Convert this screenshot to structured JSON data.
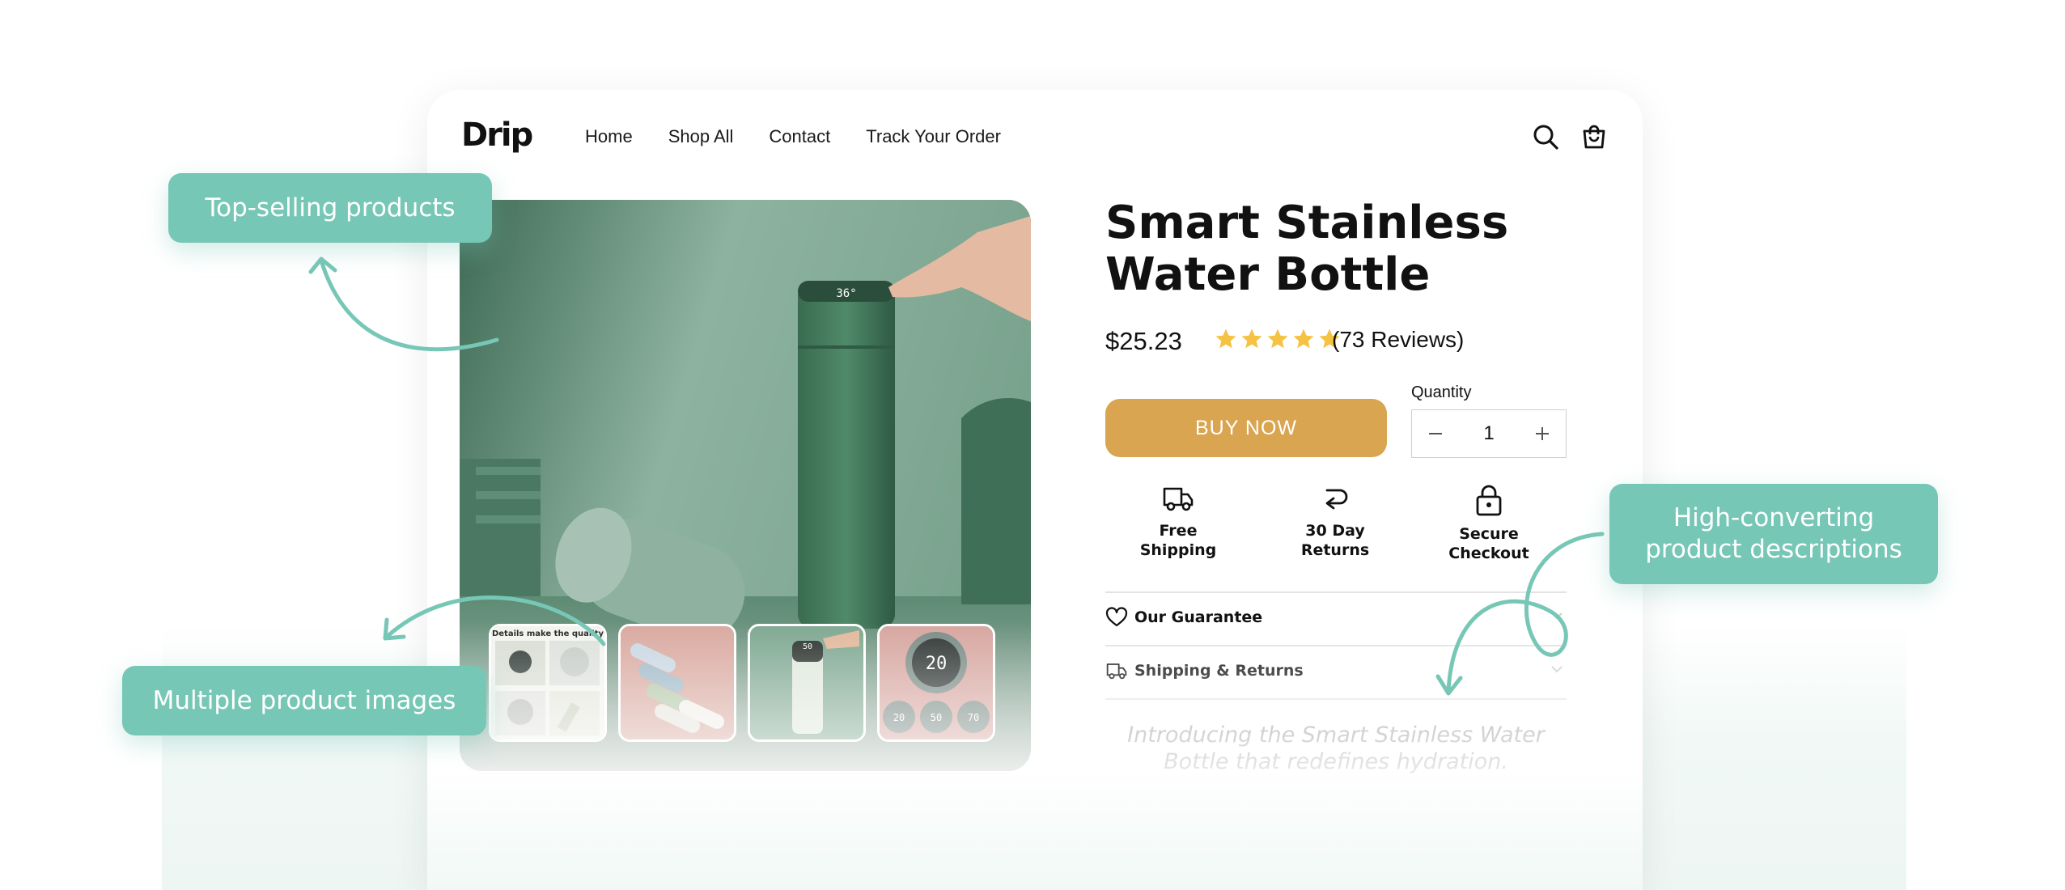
{
  "header": {
    "logo": "Drip",
    "nav": [
      "Home",
      "Shop All",
      "Contact",
      "Track Your Order"
    ],
    "icons": [
      "search-icon",
      "cart-icon"
    ]
  },
  "product": {
    "title": "Smart Stainless Water Bottle",
    "price": "$25.23",
    "rating": 5,
    "reviews": "(73 Reviews)",
    "buy_label": "BUY NOW",
    "quantity_label": "Quantity",
    "quantity_value": "1",
    "thumbnail_caption": "Details make the quality",
    "thumbnail_readouts": [
      "50",
      "20",
      "20",
      "50",
      "70"
    ],
    "features": [
      {
        "line1": "Free",
        "line2": "Shipping",
        "icon": "truck-icon"
      },
      {
        "line1": "30 Day",
        "line2": "Returns",
        "icon": "return-arrow-icon"
      },
      {
        "line1": "Secure",
        "line2": "Checkout",
        "icon": "lock-icon"
      }
    ],
    "accordion": [
      {
        "label": "Our Guarantee",
        "icon": "heart-icon"
      },
      {
        "label": "Shipping & Returns",
        "icon": "truck-icon"
      }
    ],
    "description": "Introducing the Smart Stainless Water Bottle that redefines hydration."
  },
  "callouts": {
    "top_selling": "Top-selling products",
    "multiple_images": "Multiple product images",
    "descriptions": "High-converting product descriptions"
  },
  "colors": {
    "accent": "#77c7b6",
    "buy_button": "#d9a551",
    "star": "#f4c344",
    "product_green": "#4d7a63"
  }
}
